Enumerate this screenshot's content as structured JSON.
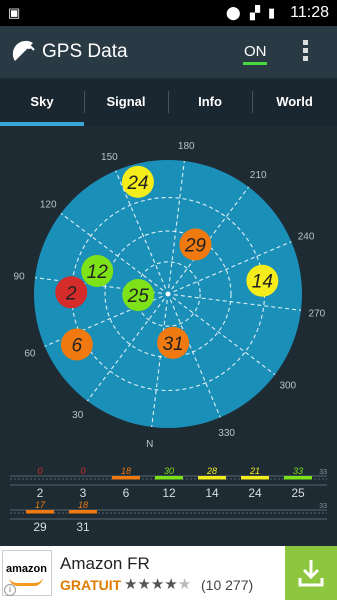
{
  "status_bar": {
    "time": "11:28"
  },
  "app": {
    "title": "GPS Data",
    "toggle_label": "ON"
  },
  "tabs": [
    {
      "label": "Sky",
      "active": true
    },
    {
      "label": "Signal",
      "active": false
    },
    {
      "label": "Info",
      "active": false
    },
    {
      "label": "World",
      "active": false
    }
  ],
  "sky": {
    "azimuth_labels": [
      "150",
      "180",
      "210",
      "240",
      "270",
      "300",
      "330",
      "N",
      "30",
      "60",
      "90",
      "120"
    ],
    "satellites": [
      {
        "id": "24",
        "color": "#f4ec1b",
        "azimuth": 158,
        "elevation": 12
      },
      {
        "id": "12",
        "color": "#7de218",
        "azimuth": 101,
        "elevation": 40
      },
      {
        "id": "2",
        "color": "#d42b2b",
        "azimuth": 84,
        "elevation": 25
      },
      {
        "id": "29",
        "color": "#f07a10",
        "azimuth": 202,
        "elevation": 52
      },
      {
        "id": "25",
        "color": "#7de218",
        "azimuth": 81,
        "elevation": 70
      },
      {
        "id": "14",
        "color": "#f4ec1b",
        "azimuth": 255,
        "elevation": 26
      },
      {
        "id": "6",
        "color": "#f07a10",
        "azimuth": 54,
        "elevation": 20
      },
      {
        "id": "31",
        "color": "#f07a10",
        "azimuth": 347,
        "elevation": 57
      }
    ]
  },
  "signal": {
    "max_label": "33",
    "rows": [
      [
        {
          "id": "2",
          "snr": "0",
          "color": "#d42b2b"
        },
        {
          "id": "3",
          "snr": "0",
          "color": "#d42b2b"
        },
        {
          "id": "6",
          "snr": "18",
          "color": "#f07a10"
        },
        {
          "id": "12",
          "snr": "30",
          "color": "#7de218"
        },
        {
          "id": "14",
          "snr": "28",
          "color": "#f4ec1b"
        },
        {
          "id": "24",
          "snr": "21",
          "color": "#f4ec1b"
        },
        {
          "id": "25",
          "snr": "33",
          "color": "#7de218"
        }
      ],
      [
        {
          "id": "29",
          "snr": "17",
          "color": "#f07a10"
        },
        {
          "id": "31",
          "snr": "18",
          "color": "#f07a10"
        }
      ]
    ]
  },
  "ad": {
    "logo_text": "amazon",
    "name": "Amazon FR",
    "price": "GRATUIT",
    "rating_stars": "★★★★★",
    "rating_count": "(10 277)",
    "rating_value": 4.5
  }
}
